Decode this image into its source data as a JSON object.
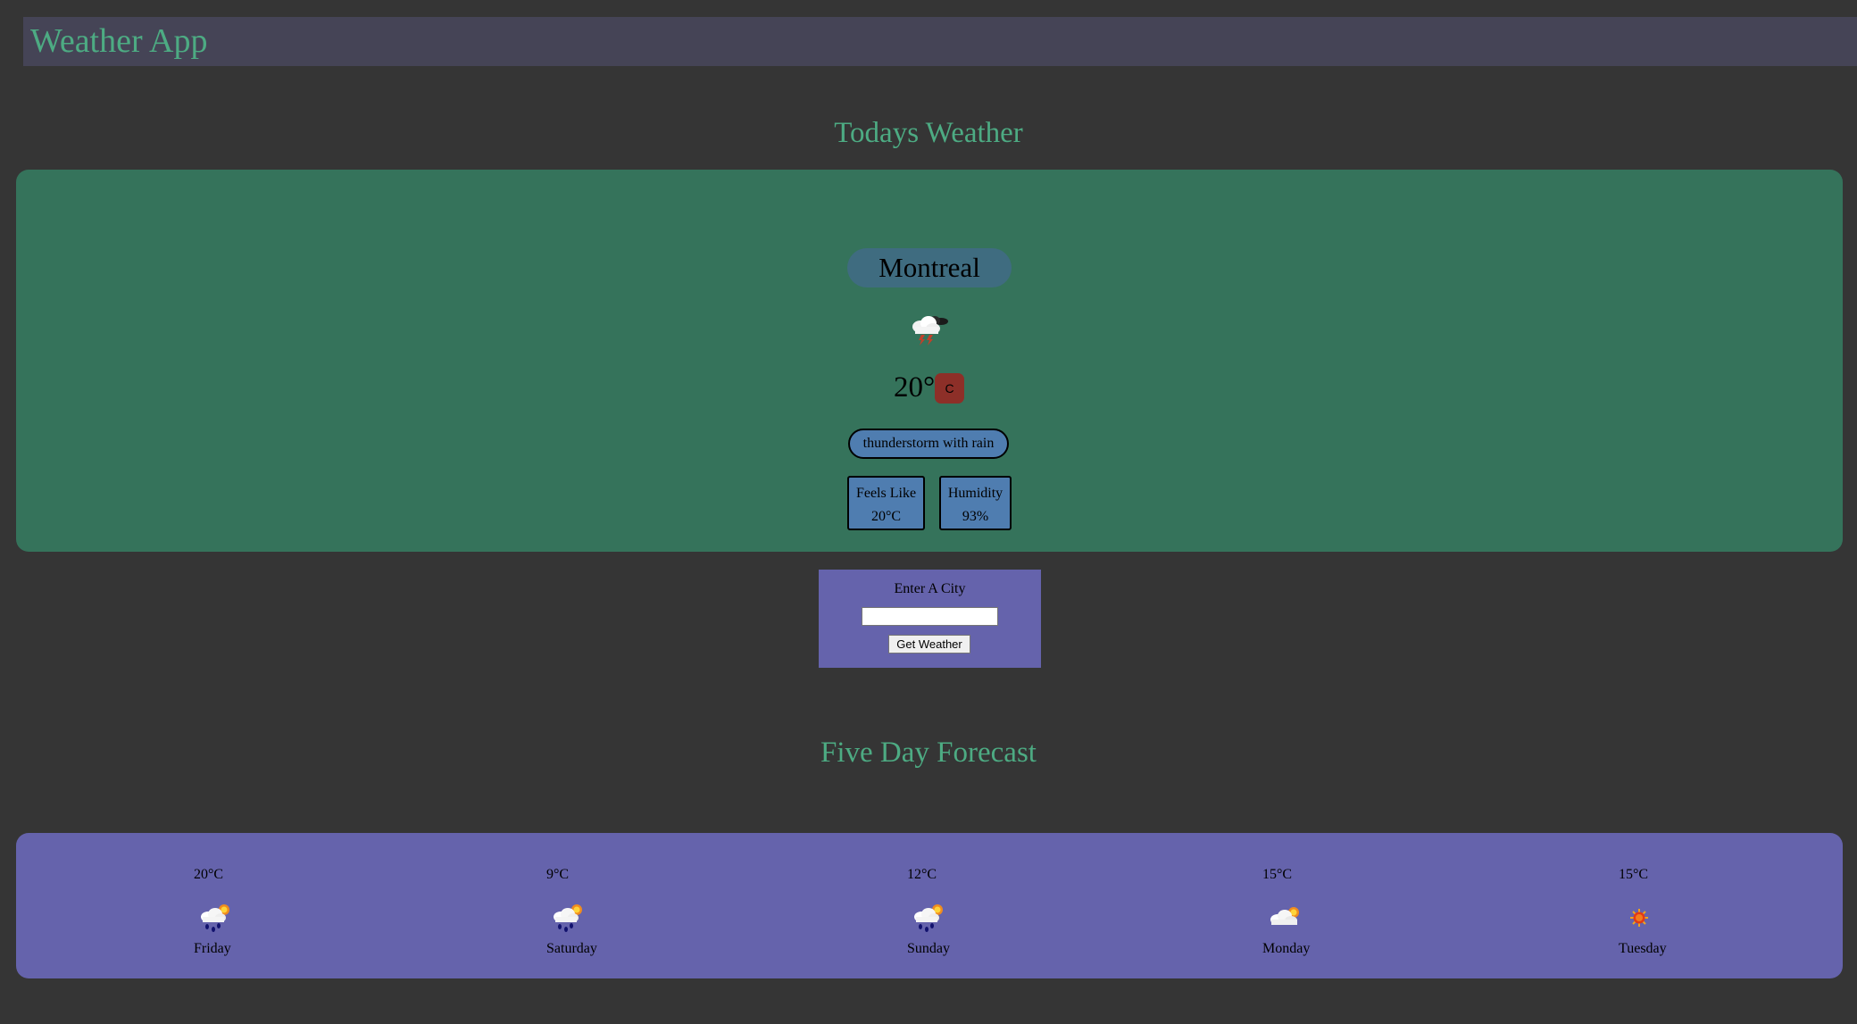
{
  "header": {
    "title": "Weather App"
  },
  "today": {
    "section_title": "Todays Weather",
    "city": "Montreal",
    "icon": "thunderstorm-rain-icon",
    "temperature": "20°",
    "unit_toggle": "C",
    "condition": "thunderstorm with rain",
    "feels_like": {
      "label": "Feels Like",
      "value": "20°C"
    },
    "humidity": {
      "label": "Humidity",
      "value": "93%"
    }
  },
  "search": {
    "label": "Enter A City",
    "input_value": "",
    "button_label": "Get Weather"
  },
  "forecast": {
    "section_title": "Five Day Forecast",
    "days": [
      {
        "temp": "20°C",
        "icon": "rain-sun-icon",
        "day": "Friday"
      },
      {
        "temp": "9°C",
        "icon": "rain-sun-icon",
        "day": "Saturday"
      },
      {
        "temp": "12°C",
        "icon": "rain-sun-icon",
        "day": "Sunday"
      },
      {
        "temp": "15°C",
        "icon": "cloud-sun-icon",
        "day": "Monday"
      },
      {
        "temp": "15°C",
        "icon": "sun-icon",
        "day": "Tuesday"
      }
    ]
  },
  "colors": {
    "page_background": "#353535",
    "header_background": "#454456",
    "accent_green_text": "#4dab83",
    "today_card": "#35735b",
    "city_pill": "#3f6c80",
    "unit_toggle": "#8d2f28",
    "info_boxes": "#4f7db0",
    "purple_panels": "#6563ac"
  }
}
